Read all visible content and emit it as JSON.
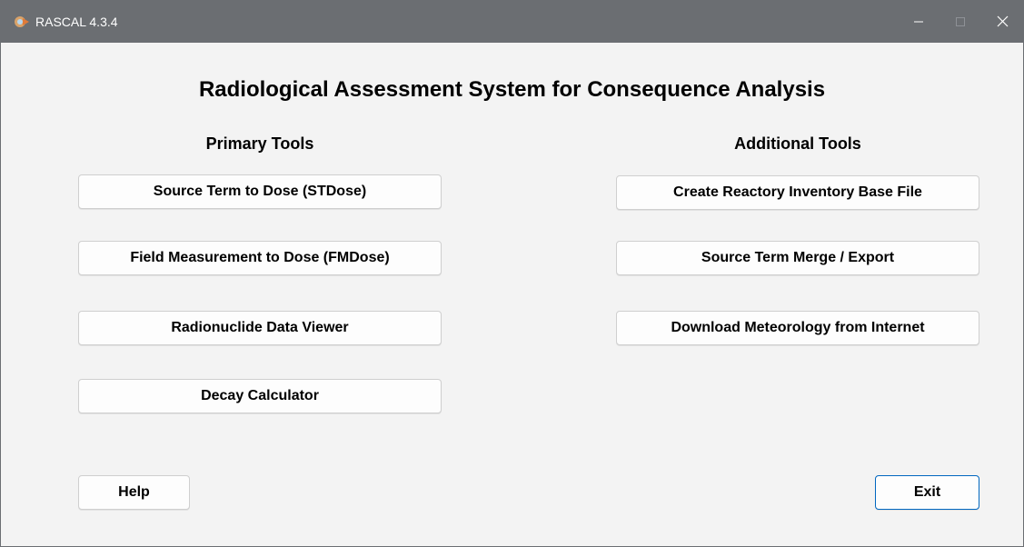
{
  "window": {
    "title": "RASCAL 4.3.4",
    "app_icon": "rascal-app-icon",
    "controls": {
      "minimize": "minimize-icon",
      "maximize": "maximize-icon",
      "close": "close-icon"
    }
  },
  "main": {
    "title": "Radiological Assessment System for Consequence Analysis",
    "primary": {
      "heading": "Primary Tools",
      "buttons": [
        "Source Term to Dose (STDose)",
        "Field Measurement to Dose (FMDose)",
        "Radionuclide Data Viewer",
        "Decay Calculator"
      ]
    },
    "additional": {
      "heading": "Additional Tools",
      "buttons": [
        "Create Reactory Inventory Base File",
        "Source Term Merge / Export",
        "Download Meteorology from Internet"
      ]
    }
  },
  "footer": {
    "help_label": "Help",
    "exit_label": "Exit"
  },
  "colors": {
    "titlebar": "#6b6e72",
    "background": "#f3f3f3",
    "button_face": "#fdfdfd",
    "focus_border": "#0067c0"
  }
}
